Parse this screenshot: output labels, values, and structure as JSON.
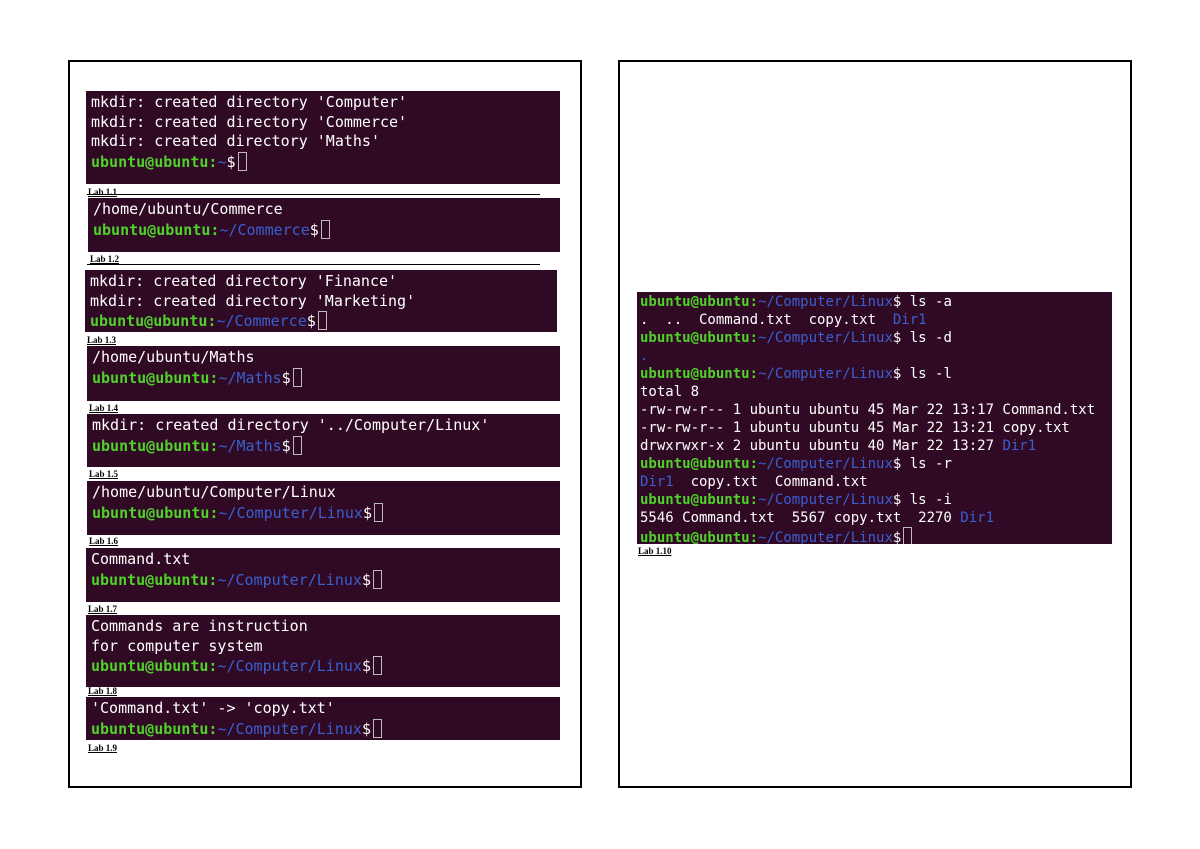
{
  "prompt": {
    "user": "ubuntu@ubuntu",
    "colon": ":",
    "dollar": "$"
  },
  "blocks": [
    {
      "caption": "Lab 1.1",
      "lines": [
        {
          "text": "mkdir: created directory 'Computer'"
        },
        {
          "text": "mkdir: created directory 'Commerce'"
        },
        {
          "text": "mkdir: created directory 'Maths'"
        },
        {
          "path": "~"
        }
      ]
    },
    {
      "caption": "Lab 1.2",
      "lines": [
        {
          "text": "/home/ubuntu/Commerce"
        },
        {
          "path": "~/Commerce"
        }
      ]
    },
    {
      "caption": "Lab 1.3",
      "lines": [
        {
          "text": "mkdir: created directory 'Finance'"
        },
        {
          "text": "mkdir: created directory 'Marketing'"
        },
        {
          "path": "~/Commerce"
        }
      ]
    },
    {
      "caption": "Lab 1.4",
      "lines": [
        {
          "text": "/home/ubuntu/Maths"
        },
        {
          "path": "~/Maths"
        }
      ]
    },
    {
      "caption": "Lab 1.5",
      "lines": [
        {
          "text": "mkdir: created directory '../Computer/Linux'"
        },
        {
          "path": "~/Maths"
        }
      ]
    },
    {
      "caption": "Lab 1.6",
      "lines": [
        {
          "text": "/home/ubuntu/Computer/Linux"
        },
        {
          "path": "~/Computer/Linux"
        }
      ]
    },
    {
      "caption": "Lab 1.7",
      "lines": [
        {
          "text": "Command.txt"
        },
        {
          "path": "~/Computer/Linux"
        }
      ]
    },
    {
      "caption": "Lab 1.8",
      "lines": [
        {
          "text": "Commands are instruction"
        },
        {
          "text": "for computer system"
        },
        {
          "path": "~/Computer/Linux"
        }
      ]
    },
    {
      "caption": "Lab 1.9",
      "lines": [
        {
          "text": "'Command.txt' -> 'copy.txt'"
        },
        {
          "path": "~/Computer/Linux"
        }
      ]
    }
  ],
  "right_block": {
    "caption": "Lab 1.10",
    "path": "~/Computer/Linux",
    "lines": [
      {
        "cmd": "ls -a"
      },
      {
        "segs": [
          {
            "t": ".  ..  Command.txt  copy.txt  "
          },
          {
            "t": "Dir1",
            "dir": true
          }
        ]
      },
      {
        "cmd": "ls -d"
      },
      {
        "segs": [
          {
            "t": ".",
            "dir": true
          }
        ]
      },
      {
        "cmd": "ls -l"
      },
      {
        "segs": [
          {
            "t": "total 8"
          }
        ]
      },
      {
        "segs": [
          {
            "t": "-rw-rw-r-- 1 ubuntu ubuntu 45 Mar 22 13:17 Command.txt"
          }
        ]
      },
      {
        "segs": [
          {
            "t": "-rw-rw-r-- 1 ubuntu ubuntu 45 Mar 22 13:21 copy.txt"
          }
        ]
      },
      {
        "segs": [
          {
            "t": "drwxrwxr-x 2 ubuntu ubuntu 40 Mar 22 13:27 "
          },
          {
            "t": "Dir1",
            "dir": true
          }
        ]
      },
      {
        "cmd": "ls -r"
      },
      {
        "segs": [
          {
            "t": "Dir1",
            "dir": true
          },
          {
            "t": "  copy.txt  Command.txt"
          }
        ]
      },
      {
        "cmd": "ls -i"
      },
      {
        "segs": [
          {
            "t": "5546 Command.txt  5567 copy.txt  2270 "
          },
          {
            "t": "Dir1",
            "dir": true
          }
        ]
      },
      {
        "cmd": ""
      }
    ]
  }
}
